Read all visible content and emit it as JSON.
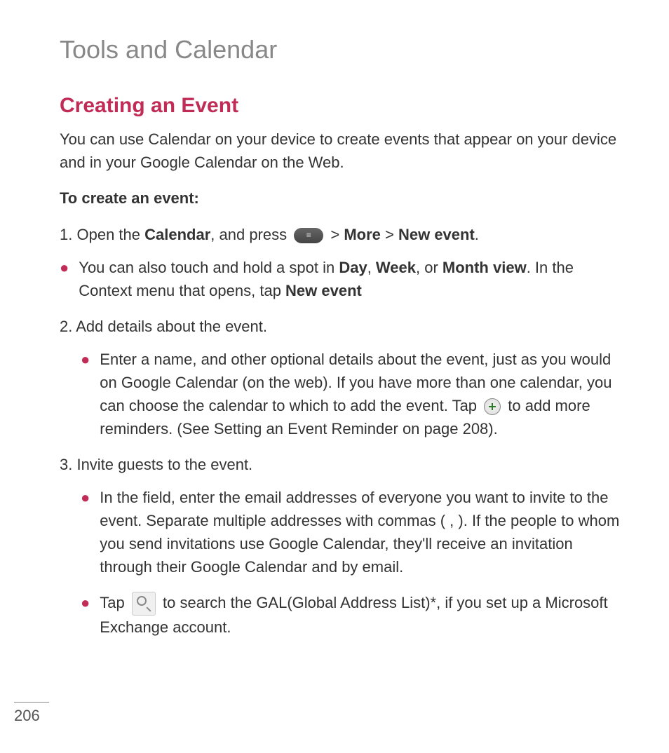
{
  "chapter_title": "Tools and Calendar",
  "section_title": "Creating an Event",
  "intro_text": "You can use Calendar on your device to create events that appear on your device and in your Google Calendar on the Web.",
  "sub_heading": "To create an event:",
  "step1": {
    "number": "1.",
    "part1": "Open the ",
    "bold1": "Calendar",
    "part2": ", and press ",
    "sep1": " > ",
    "bold2": "More",
    "sep2": " > ",
    "bold3": "New event",
    "end": "."
  },
  "bullet1": {
    "part1": "You can also touch and hold a spot in ",
    "bold1": "Day",
    "sep1": ", ",
    "bold2": "Week",
    "sep2": ", or ",
    "bold3": "Month view",
    "part2": ". In the Context menu that opens, tap ",
    "bold4": "New event"
  },
  "step2": "2. Add details about the event.",
  "bullet2": {
    "part1": "Enter a name, and other optional details about the event, just as you would on Google Calendar (on the web). If you have more than one calendar, you can choose the calendar to which to add the event. Tap ",
    "part2": " to add more reminders. (See Setting an Event Reminder on page 208)."
  },
  "step3": "3. Invite guests to the event.",
  "bullet3": "In the field, enter the email addresses of everyone you want to invite to the event. Separate multiple addresses with commas ( , ). If the people to whom you send invitations use Google Calendar, they'll receive an invitation through their Google Calendar and by email.",
  "bullet4": {
    "part1": "Tap ",
    "part2": " to search the GAL(Global Address List)*, if you set up a Microsoft Exchange account."
  },
  "page_number": "206"
}
